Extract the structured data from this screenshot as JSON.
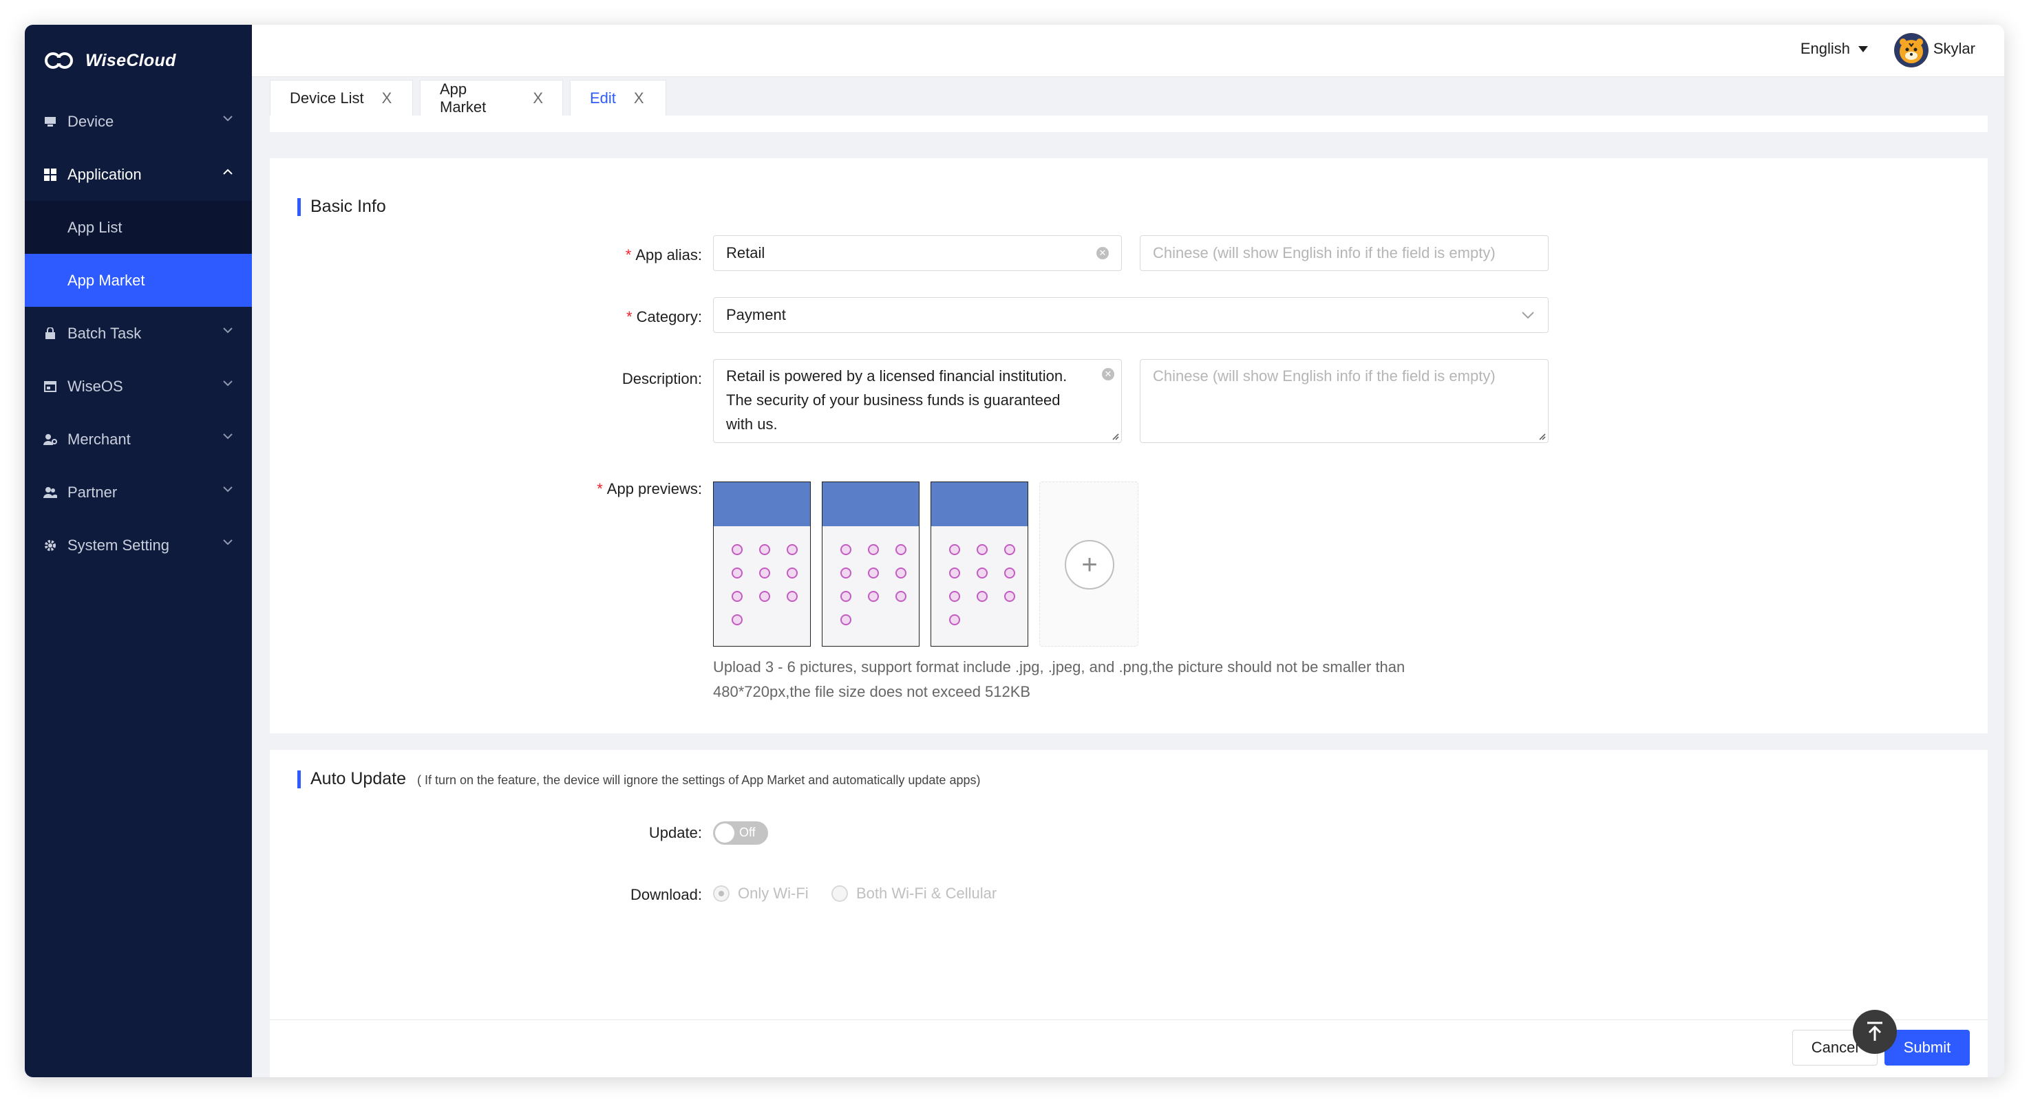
{
  "brand": {
    "name": "WiseCloud"
  },
  "sidebar": {
    "items": [
      {
        "label": "Device",
        "icon": "device-icon"
      },
      {
        "label": "Application",
        "icon": "grid-icon",
        "open": true,
        "children": [
          {
            "label": "App List"
          },
          {
            "label": "App Market",
            "active": true
          }
        ]
      },
      {
        "label": "Batch Task",
        "icon": "lock-icon"
      },
      {
        "label": "WiseOS",
        "icon": "window-icon"
      },
      {
        "label": "Merchant",
        "icon": "merchant-icon"
      },
      {
        "label": "Partner",
        "icon": "partner-icon"
      },
      {
        "label": "System Setting",
        "icon": "gear-icon"
      }
    ]
  },
  "header": {
    "language": "English",
    "user": "Skylar"
  },
  "tabs": [
    {
      "label": "Device List",
      "close": "X"
    },
    {
      "label": "App Market",
      "close": "X"
    },
    {
      "label": "Edit",
      "close": "X",
      "active": true
    }
  ],
  "basic_info": {
    "title": "Basic Info",
    "app_alias": {
      "label": "App alias",
      "value": "Retail",
      "cn_placeholder": "Chinese (will show English info if the field is empty)"
    },
    "category": {
      "label": "Category",
      "value": "Payment"
    },
    "description": {
      "label": "Description",
      "lines": [
        "Retail is powered by a licensed financial institution.",
        "The security of your business funds is guaranteed",
        "with us."
      ],
      "cn_placeholder": "Chinese (will show English info if the field is empty)"
    },
    "previews": {
      "label": "App previews",
      "count": 3,
      "hint_lines": [
        "Upload 3 - 6 pictures, support format include .jpg, .jpeg, and .png,the picture should not be smaller than",
        "480*720px,the file size does not exceed 512KB"
      ]
    }
  },
  "auto_update": {
    "title": "Auto Update",
    "note": "( If turn on the feature, the device will ignore the settings of App Market and automatically update apps)",
    "update": {
      "label": "Update",
      "state": "Off"
    },
    "download": {
      "label": "Download",
      "options": [
        "Only Wi-Fi",
        "Both Wi-Fi & Cellular"
      ],
      "selected": 0
    }
  },
  "footer": {
    "cancel": "Cancel",
    "submit": "Submit"
  },
  "colors": {
    "sidebar_bg": "#0f1b3d",
    "accent": "#2d5bff",
    "required": "#f5222d"
  }
}
